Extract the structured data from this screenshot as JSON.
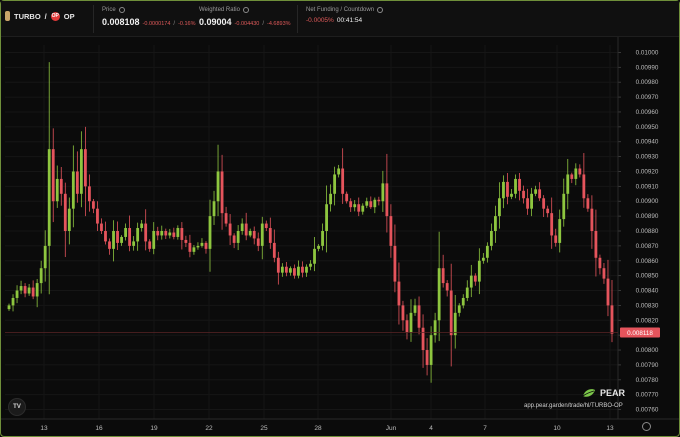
{
  "pair": {
    "base": "TURBO",
    "separator": "/",
    "quote": "OP"
  },
  "price": {
    "label": "Price",
    "value": "0.008108",
    "change_abs": "-0.0000174",
    "slash": "/",
    "change_pct": "-0.16%"
  },
  "weighted_ratio": {
    "label": "Weighted Ratio",
    "value": "0.09004",
    "change_abs": "-0.004430",
    "slash": "/",
    "change_pct": "-4.6893%"
  },
  "funding": {
    "label": "Net Funding / Countdown",
    "rate": "-0.0005%",
    "countdown": "00:41:54"
  },
  "branding": {
    "name": "PEAR",
    "url": "app.pear.garden/trade/hl/TURBO-OP",
    "tv_badge": "TV"
  },
  "colors": {
    "up": "#8ec63f",
    "down": "#e5545c",
    "bg": "#0b0b0b",
    "price_tag": "#e5545c"
  },
  "chart_data": {
    "type": "candlestick",
    "y_ticks": [
      "0.01000",
      "0.00990",
      "0.00980",
      "0.00970",
      "0.00960",
      "0.00950",
      "0.00940",
      "0.00930",
      "0.00920",
      "0.00910",
      "0.00900",
      "0.00890",
      "0.00880",
      "0.00870",
      "0.00860",
      "0.00850",
      "0.00840",
      "0.00830",
      "0.00820",
      "0.00810",
      "0.00800",
      "0.00790",
      "0.00780",
      "0.00770",
      "0.00760"
    ],
    "ylim": [
      0.00755,
      0.01005
    ],
    "x_ticks": [
      "13",
      "16",
      "19",
      "22",
      "25",
      "28",
      "Jun",
      "4",
      "7",
      "10",
      "13"
    ],
    "last_price_label": "0.008118",
    "last_price": 0.008118,
    "closes": [
      0.0083,
      0.00835,
      0.0084,
      0.00843,
      0.00838,
      0.00842,
      0.00836,
      0.00845,
      0.00855,
      0.0087,
      0.00935,
      0.009,
      0.00915,
      0.00905,
      0.0088,
      0.00895,
      0.0092,
      0.00905,
      0.00935,
      0.0091,
      0.009,
      0.00895,
      0.00885,
      0.0088,
      0.00873,
      0.00868,
      0.0088,
      0.00872,
      0.00876,
      0.00882,
      0.0087,
      0.00873,
      0.00882,
      0.00885,
      0.00873,
      0.00868,
      0.0088,
      0.00877,
      0.0088,
      0.00877,
      0.00879,
      0.00876,
      0.00882,
      0.00874,
      0.00872,
      0.00866,
      0.00869,
      0.0087,
      0.00872,
      0.00868,
      0.0089,
      0.009,
      0.0092,
      0.00892,
      0.00885,
      0.00877,
      0.00872,
      0.0088,
      0.00885,
      0.00877,
      0.0088,
      0.00875,
      0.0087,
      0.00885,
      0.00882,
      0.00872,
      0.00862,
      0.00852,
      0.00856,
      0.00852,
      0.00855,
      0.0085,
      0.00856,
      0.00852,
      0.00856,
      0.00858,
      0.00868,
      0.0087,
      0.0088,
      0.00898,
      0.00905,
      0.00918,
      0.00922,
      0.00905,
      0.009,
      0.00896,
      0.00898,
      0.00893,
      0.00897,
      0.009,
      0.00896,
      0.00901,
      0.009,
      0.00912,
      0.0089,
      0.0087,
      0.00846,
      0.0083,
      0.0082,
      0.00812,
      0.00825,
      0.0083,
      0.00815,
      0.008,
      0.0079,
      0.0081,
      0.0082,
      0.00855,
      0.00845,
      0.0084,
      0.0081,
      0.00825,
      0.0083,
      0.00835,
      0.00842,
      0.0085,
      0.00846,
      0.0086,
      0.00862,
      0.0087,
      0.0088,
      0.0089,
      0.00902,
      0.00913,
      0.00903,
      0.00905,
      0.00915,
      0.00907,
      0.00902,
      0.00895,
      0.00905,
      0.00908,
      0.00902,
      0.00895,
      0.00892,
      0.00877,
      0.00872,
      0.00888,
      0.00905,
      0.00918,
      0.00915,
      0.00922,
      0.00918,
      0.00902,
      0.00895,
      0.0088,
      0.00862,
      0.00855,
      0.00848,
      0.0083,
      0.00811
    ],
    "opens_from_prev": true
  }
}
